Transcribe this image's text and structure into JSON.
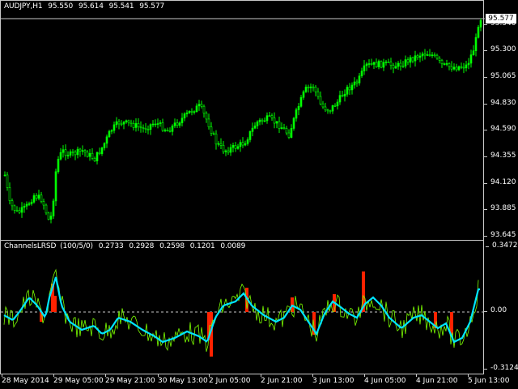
{
  "main_chart": {
    "symbol": "AUDJPY,H1",
    "ohlc": [
      "95.550",
      "95.614",
      "95.541",
      "95.577"
    ],
    "current_price": "95.577",
    "price_labels": [
      "95.540",
      "95.300",
      "95.065",
      "94.830",
      "94.590",
      "94.355",
      "94.120",
      "93.885",
      "93.645"
    ],
    "colors": {
      "candle": "#00ff00",
      "axis": "#c8c8c8",
      "background": "#000000",
      "price_line": "#c8c8c8"
    }
  },
  "indicator": {
    "name": "ChannelsLRSD",
    "params": "(100/5/0)",
    "values": [
      "0.2733",
      "0.2928",
      "0.2598",
      "0.1201",
      "0.0089"
    ],
    "axis_labels": {
      "top": "0.3472",
      "mid": "0.00",
      "bottom": "-0.3124"
    },
    "colors": {
      "main_line": "#00e5ff",
      "fast_line": "#7cff00",
      "histogram": "#ff2200",
      "zero_line": "#c8c8c8"
    }
  },
  "time_labels": [
    "28 May 2014",
    "29 May 05:00",
    "29 May 21:00",
    "30 May 13:00",
    "2 Jun 05:00",
    "2 Jun 21:00",
    "3 Jun 13:00",
    "4 Jun 05:00",
    "4 Jun 21:00",
    "5 Jun 13:00"
  ]
}
